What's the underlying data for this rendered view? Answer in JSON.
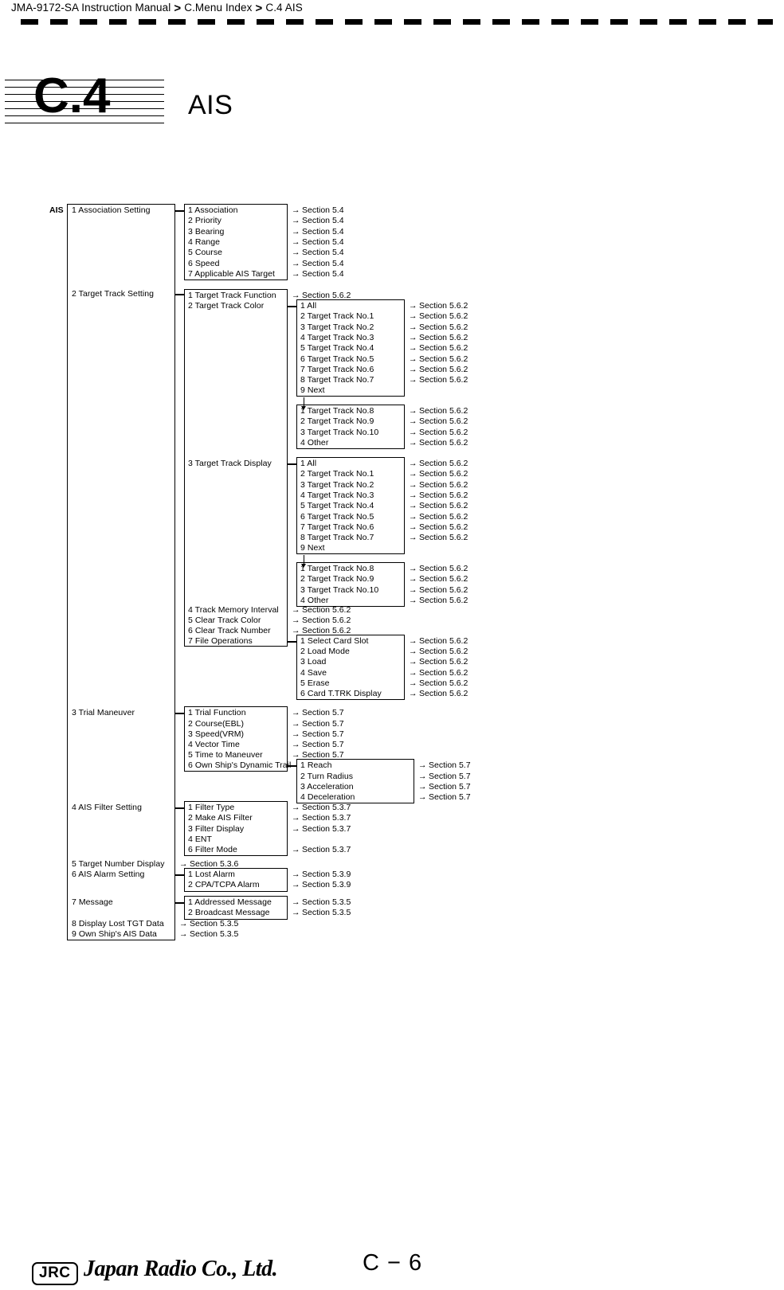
{
  "header": {
    "breadcrumb": [
      "JMA-9172-SA Instruction Manual",
      "C.Menu Index",
      "C.4  AIS"
    ],
    "separator": ">"
  },
  "chapter": {
    "number": "C.4",
    "title": "AIS"
  },
  "root_label": "AIS",
  "arrow": "→",
  "tree": {
    "level1": [
      {
        "label": "1  Association Setting"
      },
      {
        "label": "2  Target Track Setting"
      },
      {
        "label": "3  Trial Maneuver"
      },
      {
        "label": "4  AIS Filter Setting"
      },
      {
        "label": "5  Target Number Display",
        "section": "Section 5.3.6"
      },
      {
        "label": "6  AIS Alarm Setting"
      },
      {
        "label": "7  Message"
      },
      {
        "label": "8  Display Lost TGT Data",
        "section": "Section 5.3.5"
      },
      {
        "label": "9  Own Ship's AIS Data",
        "section": "Section 5.3.5"
      }
    ],
    "association_setting": [
      {
        "label": "1  Association",
        "section": "Section 5.4"
      },
      {
        "label": "2  Priority",
        "section": "Section 5.4"
      },
      {
        "label": "3  Bearing",
        "section": "Section 5.4"
      },
      {
        "label": "4  Range",
        "section": "Section 5.4"
      },
      {
        "label": "5  Course",
        "section": "Section 5.4"
      },
      {
        "label": "6  Speed",
        "section": "Section 5.4"
      },
      {
        "label": "7  Applicable AIS Target",
        "section": "Section 5.4"
      }
    ],
    "target_track_setting": [
      {
        "label": "1  Target Track Function",
        "section": "Section 5.6.2"
      },
      {
        "label": "2  Target Track Color",
        "section": ""
      },
      {
        "label": "3  Target Track Display",
        "section": ""
      },
      {
        "label": "4  Track Memory Interval",
        "section": "Section 5.6.2"
      },
      {
        "label": "5  Clear Track Color",
        "section": "Section 5.6.2"
      },
      {
        "label": "6  Clear Track Number",
        "section": "Section 5.6.2"
      },
      {
        "label": "7  File Operations",
        "section": ""
      }
    ],
    "track_color_page1": [
      {
        "label": "1 All",
        "section": "Section 5.6.2"
      },
      {
        "label": "2 Target Track No.1",
        "section": "Section 5.6.2"
      },
      {
        "label": "3 Target Track No.2",
        "section": "Section 5.6.2"
      },
      {
        "label": "4 Target Track No.3",
        "section": "Section 5.6.2"
      },
      {
        "label": "5 Target Track No.4",
        "section": "Section 5.6.2"
      },
      {
        "label": "6 Target Track No.5",
        "section": "Section 5.6.2"
      },
      {
        "label": "7 Target Track No.6",
        "section": "Section 5.6.2"
      },
      {
        "label": "8 Target Track No.7",
        "section": "Section 5.6.2"
      },
      {
        "label": "9 Next",
        "section": ""
      }
    ],
    "track_color_page2": [
      {
        "label": "1 Target Track No.8",
        "section": "Section 5.6.2"
      },
      {
        "label": "2 Target Track No.9",
        "section": "Section 5.6.2"
      },
      {
        "label": "3 Target Track No.10",
        "section": "Section 5.6.2"
      },
      {
        "label": "4 Other",
        "section": "Section 5.6.2"
      }
    ],
    "track_display_page1": [
      {
        "label": "1 All",
        "section": "Section 5.6.2"
      },
      {
        "label": "2 Target Track No.1",
        "section": "Section 5.6.2"
      },
      {
        "label": "3 Target Track No.2",
        "section": "Section 5.6.2"
      },
      {
        "label": "4 Target Track No.3",
        "section": "Section 5.6.2"
      },
      {
        "label": "5 Target Track No.4",
        "section": "Section 5.6.2"
      },
      {
        "label": "6 Target Track No.5",
        "section": "Section 5.6.2"
      },
      {
        "label": "7 Target Track No.6",
        "section": "Section 5.6.2"
      },
      {
        "label": "8 Target Track No.7",
        "section": "Section 5.6.2"
      },
      {
        "label": "9 Next",
        "section": ""
      }
    ],
    "track_display_page2": [
      {
        "label": "1 Target Track No.8",
        "section": "Section 5.6.2"
      },
      {
        "label": "2 Target Track No.9",
        "section": "Section 5.6.2"
      },
      {
        "label": "3 Target Track No.10",
        "section": "Section 5.6.2"
      },
      {
        "label": "4 Other",
        "section": "Section 5.6.2"
      }
    ],
    "file_operations": [
      {
        "label": "1 Select Card Slot",
        "section": "Section 5.6.2"
      },
      {
        "label": "2 Load Mode",
        "section": "Section 5.6.2"
      },
      {
        "label": "3 Load",
        "section": "Section 5.6.2"
      },
      {
        "label": "4 Save",
        "section": "Section 5.6.2"
      },
      {
        "label": "5 Erase",
        "section": "Section 5.6.2"
      },
      {
        "label": "6 Card T.TRK Display",
        "section": "Section 5.6.2"
      }
    ],
    "trial_maneuver": [
      {
        "label": "1  Trial Function",
        "section": "Section 5.7"
      },
      {
        "label": "2  Course(EBL)",
        "section": "Section 5.7"
      },
      {
        "label": "3  Speed(VRM)",
        "section": "Section 5.7"
      },
      {
        "label": "4  Vector Time",
        "section": "Section 5.7"
      },
      {
        "label": "5  Time to Maneuver",
        "section": "Section 5.7"
      },
      {
        "label": "6  Own Ship's Dynamic Trail",
        "section": ""
      }
    ],
    "dynamic_trail": [
      {
        "label": "1  Reach",
        "section": "Section 5.7"
      },
      {
        "label": "2  Turn Radius",
        "section": "Section 5.7"
      },
      {
        "label": "3  Acceleration",
        "section": "Section 5.7"
      },
      {
        "label": "4  Deceleration",
        "section": "Section 5.7"
      }
    ],
    "ais_filter_setting": [
      {
        "label": "1  Filter Type",
        "section": "Section 5.3.7"
      },
      {
        "label": "2  Make AIS Filter",
        "section": "Section 5.3.7"
      },
      {
        "label": "3  Filter Display",
        "section": "Section 5.3.7"
      },
      {
        "label": "4  ENT",
        "section": ""
      },
      {
        "label": "6  Filter Mode",
        "section": "Section 5.3.7"
      }
    ],
    "ais_alarm_setting": [
      {
        "label": "1  Lost  Alarm",
        "section": "Section 5.3.9"
      },
      {
        "label": "2  CPA/TCPA Alarm",
        "section": "Section 5.3.9"
      }
    ],
    "message": [
      {
        "label": "1  Addressed Message",
        "section": "Section 5.3.5"
      },
      {
        "label": "2  Broadcast Message",
        "section": "Section 5.3.5"
      }
    ]
  },
  "footer": {
    "company_badge": "JRC",
    "company_name": "Japan Radio Co., Ltd.",
    "page": "C − 6"
  }
}
